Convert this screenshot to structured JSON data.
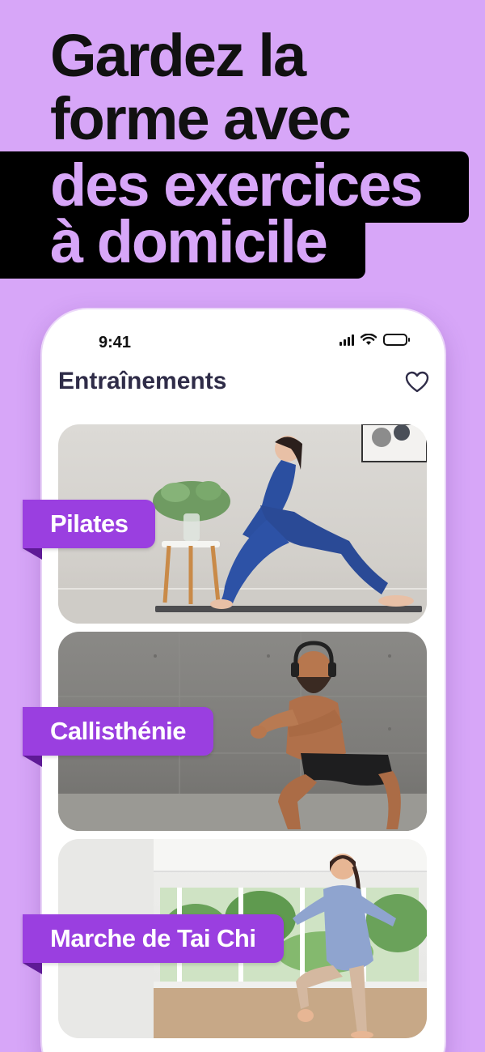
{
  "headline": {
    "line1": "Gardez la",
    "line2": "forme avec",
    "line3": "des exercices",
    "line4": "à domicile"
  },
  "colors": {
    "background": "#d7a6f8",
    "accent": "#9a3fe0",
    "band": "#000000",
    "title": "#2f2c48"
  },
  "status_bar": {
    "time": "9:41"
  },
  "app": {
    "title": "Entraînements",
    "favorite_icon": "heart-icon"
  },
  "workouts": [
    {
      "label": "Pilates"
    },
    {
      "label": "Callisthénie"
    },
    {
      "label": "Marche de Tai Chi"
    }
  ]
}
